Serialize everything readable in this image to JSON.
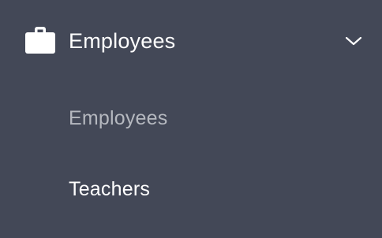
{
  "colors": {
    "background": "#434857",
    "text": "#ffffff",
    "active_text": "#b5b8bf"
  },
  "nav_group": {
    "icon": "briefcase-icon",
    "label": "Employees",
    "expanded": true,
    "chevron": "chevron-down-icon",
    "items": [
      {
        "label": "Employees",
        "active": true
      },
      {
        "label": "Teachers",
        "active": false
      }
    ]
  }
}
